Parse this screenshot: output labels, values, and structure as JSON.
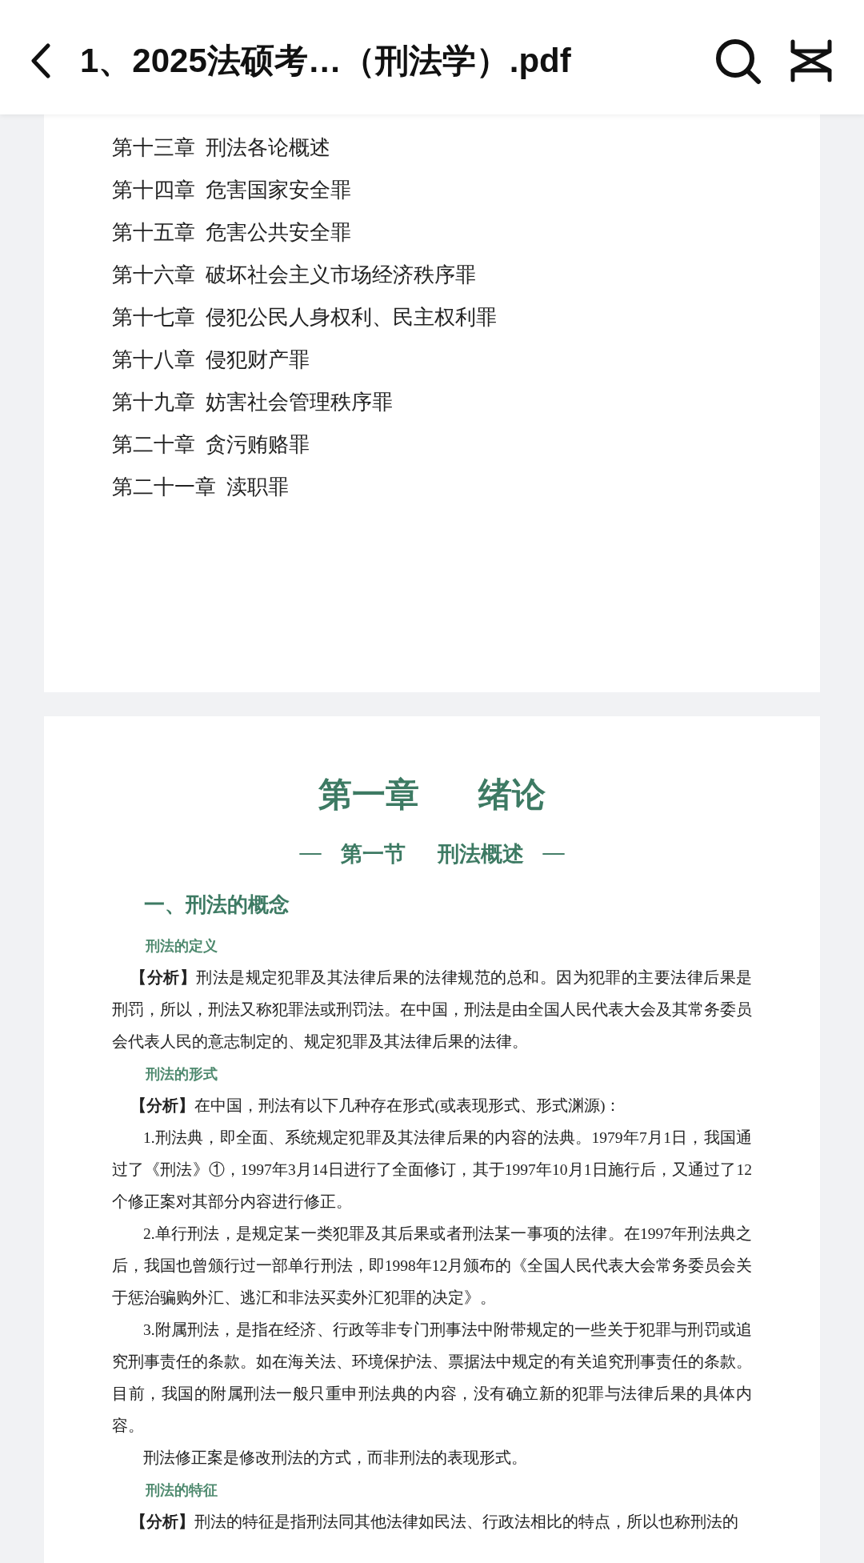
{
  "header": {
    "title": "1、2025法硕考…（刑法学）.pdf"
  },
  "toc": [
    "第十三章  刑法各论概述",
    "第十四章  危害国家安全罪",
    "第十五章  危害公共安全罪",
    "第十六章  破坏社会主义市场经济秩序罪",
    "第十七章  侵犯公民人身权利、民主权利罪",
    "第十八章  侵犯财产罪",
    "第十九章  妨害社会管理秩序罪",
    "第二十章  贪污贿赂罪",
    "第二十一章  渎职罪"
  ],
  "chapter": {
    "number": "第一章",
    "name": "绪论"
  },
  "section": {
    "dash_left": "—",
    "number": "第一节",
    "name": "刑法概述",
    "dash_right": "—"
  },
  "heading": "一、刑法的概念",
  "blocks": [
    {
      "kind": "subheading",
      "text": "刑法的定义"
    },
    {
      "kind": "analysis",
      "text": "**【分析】**刑法是规定犯罪及其法律后果的法律规范的总和。因为犯罪的主要法律后果是刑罚，所以，刑法又称犯罪法或刑罚法。在中国，刑法是由全国人民代表大会及其常务委员会代表人民的意志制定的、规定犯罪及其法律后果的法律。"
    },
    {
      "kind": "subheading",
      "text": "刑法的形式"
    },
    {
      "kind": "analysis",
      "text": "**【分析】**在中国，刑法有以下几种存在形式(或表现形式、形式渊源)："
    },
    {
      "kind": "paragraph",
      "text": "1.刑法典，即全面、系统规定犯罪及其法律后果的内容的法典。1979年7月1日，我国通过了《刑法》①，1997年3月14日进行了全面修订，其于1997年10月1日施行后，又通过了12个修正案对其部分内容进行修正。"
    },
    {
      "kind": "paragraph",
      "text": "2.单行刑法，是规定某一类犯罪及其后果或者刑法某一事项的法律。在1997年刑法典之后，我国也曾颁行过一部单行刑法，即1998年12月颁布的《全国人民代表大会常务委员会关于惩治骗购外汇、逃汇和非法买卖外汇犯罪的决定》。"
    },
    {
      "kind": "paragraph",
      "text": "3.附属刑法，是指在经济、行政等非专门刑事法中附带规定的一些关于犯罪与刑罚或追究刑事责任的条款。如在海关法、环境保护法、票据法中规定的有关追究刑事责任的条款。目前，我国的附属刑法一般只重申刑法典的内容，没有确立新的犯罪与法律后果的具体内容。"
    },
    {
      "kind": "paragraph",
      "text": "刑法修正案是修改刑法的方式，而非刑法的表现形式。"
    },
    {
      "kind": "subheading",
      "text": "刑法的特征"
    },
    {
      "kind": "analysis",
      "text": "**【分析】**刑法的特征是指刑法同其他法律如民法、行政法相比的特点，所以也称刑法的"
    }
  ]
}
